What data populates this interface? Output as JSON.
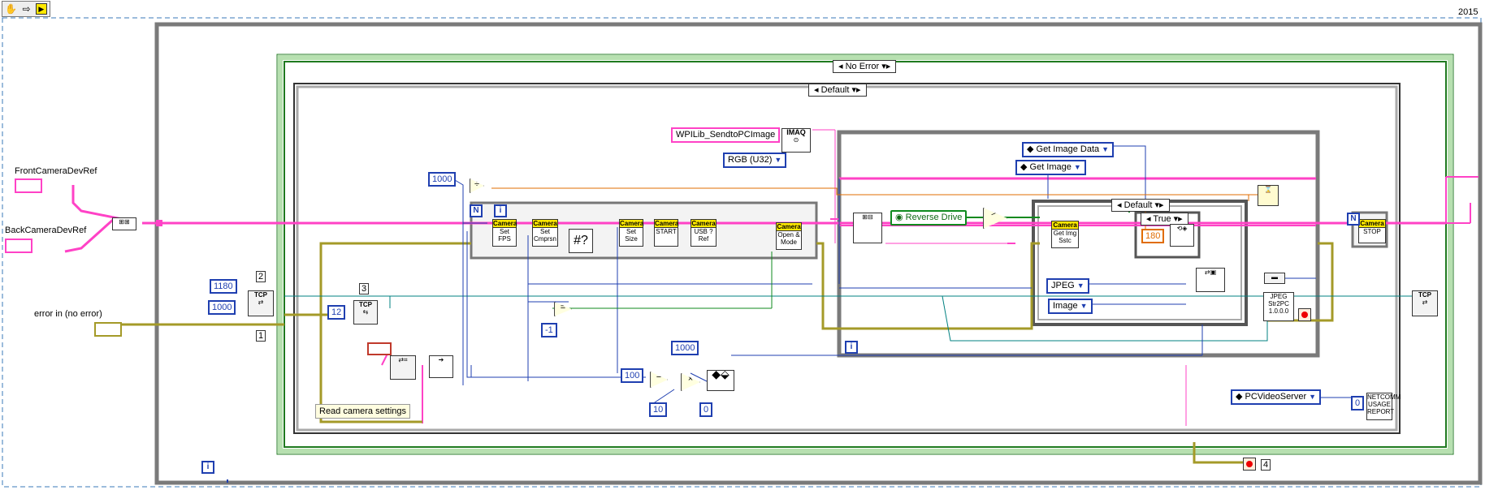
{
  "toolbar": {
    "hand_icon": "hand-icon",
    "arrow_icon": "arrow-icon",
    "run_icon": "run-icon"
  },
  "version_label": "2015",
  "case_structures": {
    "outer_selector": "No Error",
    "inner_selector": "Default",
    "image_case_selector": "Default",
    "bool_case_selector": "True"
  },
  "controls": {
    "front_camera": "FrontCameraDevRef",
    "back_camera": "BackCameraDevRef",
    "error_in": "error in (no error)"
  },
  "constants": {
    "port_1180": "1180",
    "timeout_1000_left": "1000",
    "label_2": "2",
    "label_1": "1",
    "label_3": "3",
    "const_12": "12",
    "const_1000_fps": "1000",
    "minus_one": "-1",
    "const_100": "100",
    "const_10": "10",
    "const_1000_wait": "1000",
    "const_0_a": "0",
    "const_180": "180",
    "const_0_b": "0",
    "label_4": "4",
    "loop_i": "i",
    "outer_i": "i",
    "inner_i": "i",
    "N": "N"
  },
  "strings": {
    "sendto_pc_image": "WPILib_SendtoPCImage",
    "reverse_drive": "Reverse Drive"
  },
  "rings": {
    "rgb": "RGB (U32)",
    "get_image_data": "Get Image Data",
    "get_image": "Get Image",
    "jpeg": "JPEG",
    "image": "Image",
    "pc_video_server": "PCVideoServer"
  },
  "comment": "Read camera settings",
  "camera_nodes": [
    {
      "hdr": "Camera",
      "label": "Set FPS"
    },
    {
      "hdr": "Camera",
      "label": "Set Cmprsn"
    },
    {
      "hdr": "Camera",
      "label": "Set Size"
    },
    {
      "hdr": "Camera",
      "label": "START"
    },
    {
      "hdr": "Camera",
      "label": "USB ? Ref"
    },
    {
      "hdr": "Camera",
      "label": "Open & Mode"
    },
    {
      "hdr": "Camera",
      "label": "Get Img Sstc"
    },
    {
      "hdr": "Camera",
      "label": "STOP"
    }
  ],
  "subvis": {
    "imaq": "IMAQ",
    "tcp_open": "TCP",
    "tcp_listen": "TCP",
    "tcp_close": "TCP",
    "jpeg_str": "JPEG Str2PC 1.0.0.0",
    "netcomm": "NETCOMM USAGE REPORT"
  },
  "colors": {
    "pink_wire": "#ff42c6",
    "green_wire": "#0f8a1e",
    "blue_wire": "#1f3fb0",
    "orange_wire": "#e06c00",
    "teal_wire": "#008080",
    "yellow_wire": "#c8b400"
  }
}
